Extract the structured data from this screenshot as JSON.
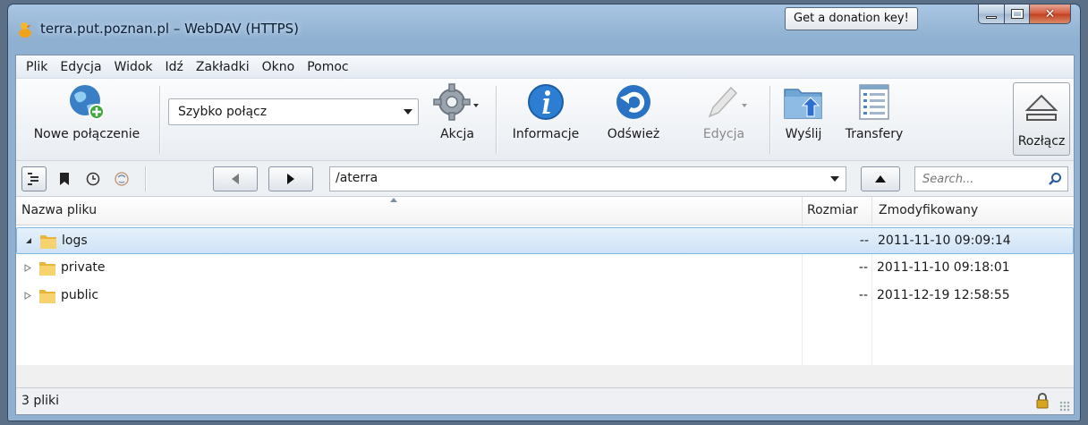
{
  "window": {
    "title": "terra.put.poznan.pl – WebDAV (HTTPS)",
    "donation_button": "Get a donation key!"
  },
  "menu": {
    "items": [
      "Plik",
      "Edycja",
      "Widok",
      "Idź",
      "Zakładki",
      "Okno",
      "Pomoc"
    ]
  },
  "toolbar": {
    "new_connection": "Nowe połączenie",
    "quick_connect_value": "Szybko połącz",
    "action": "Akcja",
    "info": "Informacje",
    "refresh": "Odśwież",
    "edit": "Edycja",
    "upload": "Wyślij",
    "transfers": "Transfery",
    "disconnect": "Rozłącz"
  },
  "navbar": {
    "path": "/aterra",
    "search_placeholder": "Search..."
  },
  "table": {
    "columns": {
      "name": "Nazwa pliku",
      "size": "Rozmiar",
      "modified": "Zmodyfikowany"
    },
    "rows": [
      {
        "name": "logs",
        "size": "--",
        "modified": "2011-11-10 09:09:14",
        "expanded": true,
        "selected": true
      },
      {
        "name": "private",
        "size": "--",
        "modified": "2011-11-10 09:18:01",
        "expanded": false,
        "selected": false
      },
      {
        "name": "public",
        "size": "--",
        "modified": "2011-12-19 12:58:55",
        "expanded": false,
        "selected": false
      }
    ]
  },
  "status": {
    "text": "3 pliki"
  },
  "colors": {
    "selection": "#cfe3f7",
    "titlebar": "#a9c6e3",
    "close": "#c33f1f"
  }
}
